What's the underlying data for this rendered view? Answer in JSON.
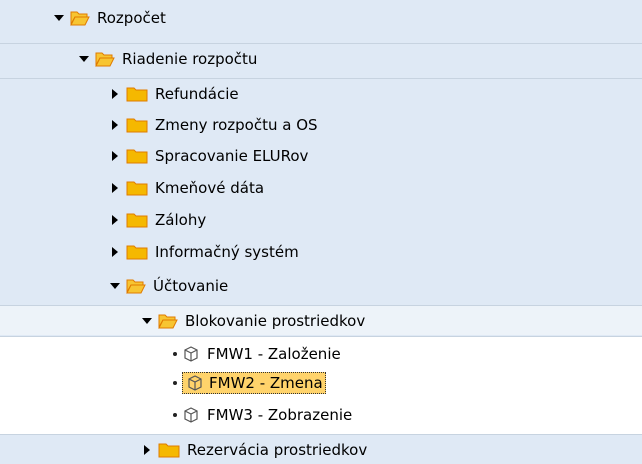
{
  "tree": {
    "rozpocet": "Rozpočet",
    "riadenie_rozpoctu": "Riadenie rozpočtu",
    "refundacie": "Refundácie",
    "zmeny_rozpoctu": "Zmeny rozpočtu a OS",
    "spracovanie_elurov": "Spracovanie ELURov",
    "kmenove_data": "Kmeňové dáta",
    "zalohy": "Zálohy",
    "informacny_system": "Informačný systém",
    "uctovanie": "Účtovanie",
    "blokovanie": "Blokovanie prostriedkov",
    "fmw1": "FMW1 - Založenie",
    "fmw2": "FMW2 - Zmena",
    "fmw3": "FMW3 - Zobrazenie",
    "rezervacia": "Rezervácia prostriedkov"
  },
  "colors": {
    "background": "#dfe9f5",
    "folder": "#f5b800",
    "folder_open": "#f7c532",
    "folder_outline": "#e07b00",
    "selection": "#ffd36b"
  }
}
